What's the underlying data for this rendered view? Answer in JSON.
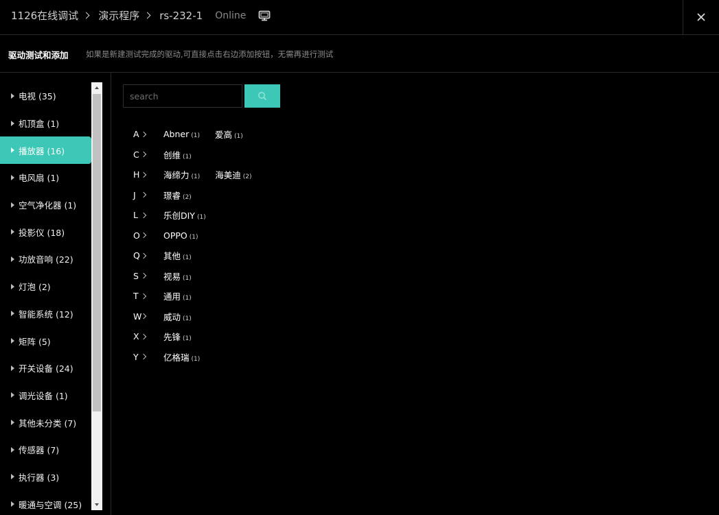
{
  "header": {
    "breadcrumb": [
      "1126在线调试",
      "演示程序",
      "rs-232-1"
    ],
    "status": "Online",
    "monitor_icon": "monitor-icon",
    "close_icon": "close-icon"
  },
  "subheader": {
    "title": "驱动测试和添加",
    "description": "如果是新建测试完成的驱动,可直接点击右边添加按钮，无需再进行测试"
  },
  "sidebar": {
    "active_index": 2,
    "items": [
      {
        "label": "电视 (35)"
      },
      {
        "label": "机顶盒 (1)"
      },
      {
        "label": "播放器 (16)"
      },
      {
        "label": "电风扇 (1)"
      },
      {
        "label": "空气净化器 (1)"
      },
      {
        "label": "投影仪 (18)"
      },
      {
        "label": "功放音响 (22)"
      },
      {
        "label": "灯泡 (2)"
      },
      {
        "label": "智能系统 (12)"
      },
      {
        "label": "矩阵 (5)"
      },
      {
        "label": "开关设备 (24)"
      },
      {
        "label": "调光设备 (1)"
      },
      {
        "label": "其他未分类 (7)"
      },
      {
        "label": "传感器 (7)"
      },
      {
        "label": "执行器 (3)"
      },
      {
        "label": "暖通与空调 (25)"
      }
    ]
  },
  "search": {
    "placeholder": "search",
    "value": "",
    "button_icon": "search-icon"
  },
  "groups": [
    {
      "letter": "A",
      "brands": [
        {
          "name": "Abner",
          "count": "(1)"
        },
        {
          "name": "爱高",
          "count": "(1)"
        }
      ]
    },
    {
      "letter": "C",
      "brands": [
        {
          "name": "创维",
          "count": "(1)"
        }
      ]
    },
    {
      "letter": "H",
      "brands": [
        {
          "name": "海缔力",
          "count": "(1)"
        },
        {
          "name": "海美迪",
          "count": "(2)"
        }
      ]
    },
    {
      "letter": "J",
      "brands": [
        {
          "name": "璟睿",
          "count": "(2)"
        }
      ]
    },
    {
      "letter": "L",
      "brands": [
        {
          "name": "乐创DIY",
          "count": "(1)"
        }
      ]
    },
    {
      "letter": "O",
      "brands": [
        {
          "name": "OPPO",
          "count": "(1)"
        }
      ]
    },
    {
      "letter": "Q",
      "brands": [
        {
          "name": "其他",
          "count": "(1)"
        }
      ]
    },
    {
      "letter": "S",
      "brands": [
        {
          "name": "视易",
          "count": "(1)"
        }
      ]
    },
    {
      "letter": "T",
      "brands": [
        {
          "name": "通用",
          "count": "(1)"
        }
      ]
    },
    {
      "letter": "W",
      "brands": [
        {
          "name": "威动",
          "count": "(1)"
        }
      ]
    },
    {
      "letter": "X",
      "brands": [
        {
          "name": "先锋",
          "count": "(1)"
        }
      ]
    },
    {
      "letter": "Y",
      "brands": [
        {
          "name": "亿格瑞",
          "count": "(1)"
        }
      ]
    }
  ],
  "colors": {
    "accent": "#3cc7b6",
    "background": "#000000",
    "divider": "#2a2a2a"
  }
}
